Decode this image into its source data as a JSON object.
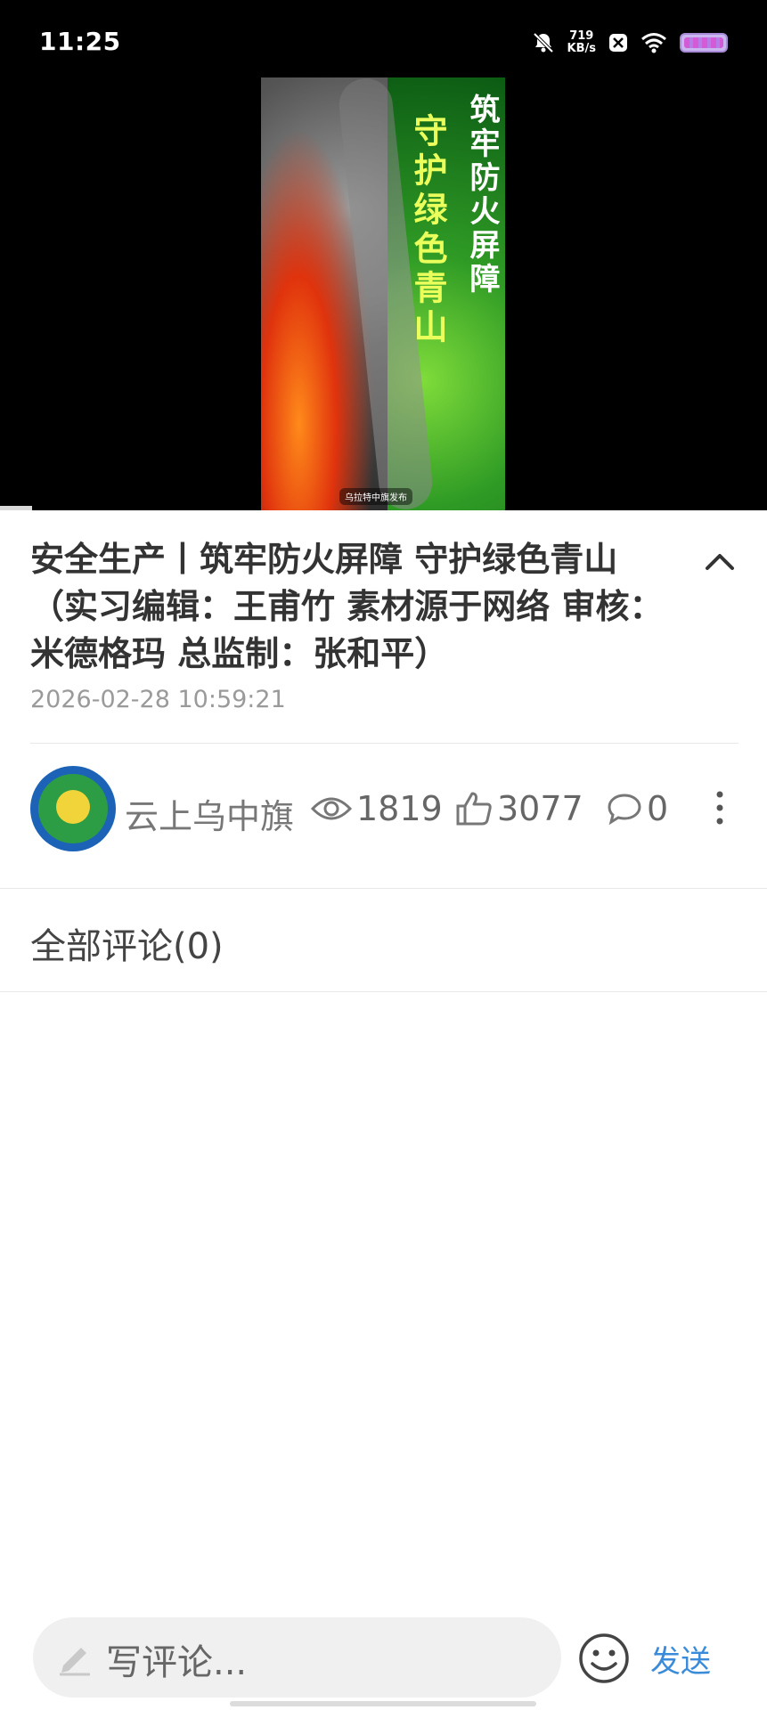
{
  "status_bar": {
    "time": "11:25",
    "net_speed_value": "719",
    "net_speed_unit": "KB/s"
  },
  "video": {
    "poster_title_right": "筑牢防火屏障",
    "poster_title_left": "守护绿色青山",
    "poster_mark": "乌拉特中旗发布"
  },
  "article": {
    "title": "安全生产丨筑牢防火屏障 守护绿色青山（实习编辑：王甫竹 素材源于网络 审核：米德格玛 总监制：张和平）",
    "datetime": "2026-02-28 10:59:21"
  },
  "channel": {
    "name": "云上乌中旗"
  },
  "stats": {
    "views": "1819",
    "likes": "3077",
    "comments": "0"
  },
  "comments_section": {
    "title": "全部评论(0)"
  },
  "composer": {
    "placeholder": "写评论...",
    "send_label": "发送"
  },
  "colors": {
    "accent": "#3a8bd9",
    "text_primary": "#333333",
    "text_secondary": "#9a9a9a"
  },
  "icons": [
    "bell-off-icon",
    "x-app-icon",
    "wifi-icon",
    "battery-icon",
    "chevron-up-icon",
    "eye-icon",
    "thumbs-up-icon",
    "comment-bubble-icon",
    "more-vertical-icon",
    "pen-icon",
    "emoji-icon"
  ]
}
